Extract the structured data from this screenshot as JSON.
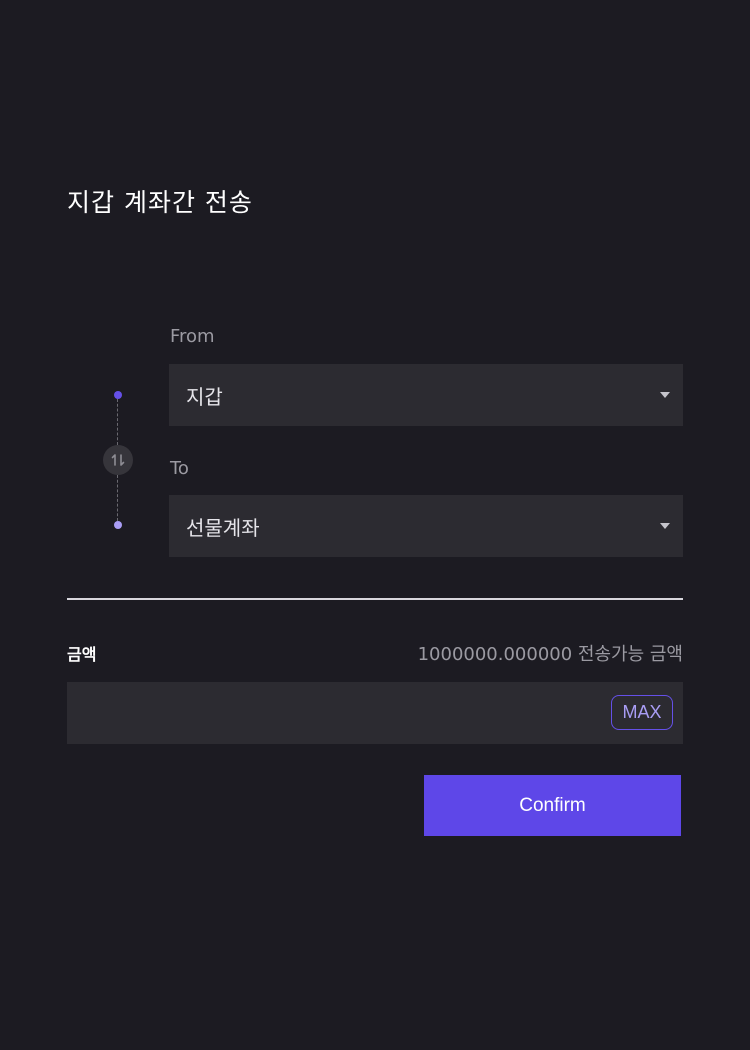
{
  "header": {
    "title": "지갑 계좌간 전송"
  },
  "transfer": {
    "from_label": "From",
    "from_value": "지갑",
    "to_label": "To",
    "to_value": "선물계좌"
  },
  "amount": {
    "label": "금액",
    "available_text": "1000000.000000 전송가능 금액",
    "input_value": "",
    "max_label": "MAX"
  },
  "actions": {
    "confirm_label": "Confirm"
  },
  "colors": {
    "background": "#1c1b22",
    "field": "#2c2b31",
    "accent": "#5e47e8",
    "accent_light": "#a99df5"
  },
  "icons": {
    "swap": "swap-vertical-icon",
    "caret": "caret-down-icon"
  }
}
